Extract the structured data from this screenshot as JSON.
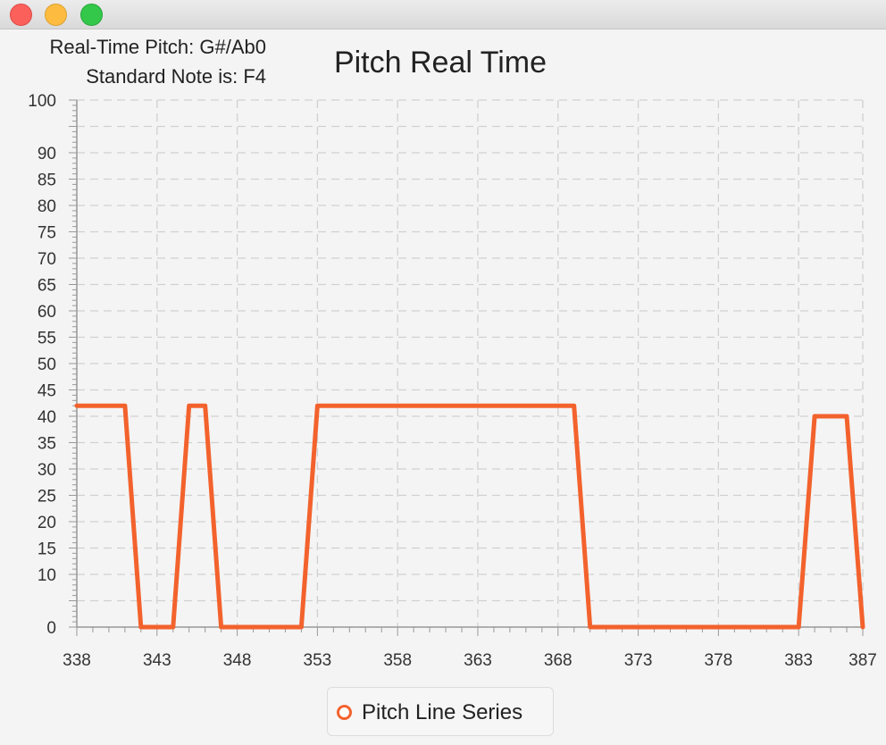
{
  "window": {
    "controls": [
      "close",
      "minimize",
      "zoom"
    ]
  },
  "info": {
    "realtime_pitch": "Real-Time Pitch: G#/Ab0",
    "standard_note": "Standard Note is: F4"
  },
  "colors": {
    "series": "#f3622d",
    "grid": "#d0d0d0",
    "axis": "#999999"
  },
  "chart_data": {
    "type": "line",
    "title": "Pitch Real Time",
    "xlabel": "",
    "ylabel": "",
    "xlim": [
      338,
      387
    ],
    "ylim": [
      0,
      100
    ],
    "x_ticks": [
      338,
      343,
      348,
      353,
      358,
      363,
      368,
      373,
      378,
      383,
      387
    ],
    "y_ticks": [
      0,
      10,
      15,
      20,
      25,
      30,
      35,
      40,
      45,
      50,
      55,
      60,
      65,
      70,
      75,
      80,
      85,
      90,
      100
    ],
    "grid": true,
    "legend_position": "bottom-center",
    "series": [
      {
        "name": "Pitch Line Series",
        "x": [
          338,
          339,
          340,
          341,
          342,
          343,
          344,
          345,
          346,
          347,
          348,
          349,
          350,
          351,
          352,
          353,
          354,
          355,
          356,
          357,
          358,
          359,
          360,
          361,
          362,
          363,
          364,
          365,
          366,
          367,
          368,
          369,
          370,
          371,
          372,
          373,
          374,
          375,
          376,
          377,
          378,
          379,
          380,
          381,
          382,
          383,
          384,
          385,
          386,
          387
        ],
        "values": [
          42,
          42,
          42,
          42,
          0,
          0,
          0,
          42,
          42,
          0,
          0,
          0,
          0,
          0,
          0,
          42,
          42,
          42,
          42,
          42,
          42,
          42,
          42,
          42,
          42,
          42,
          42,
          42,
          42,
          42,
          42,
          42,
          0,
          0,
          0,
          0,
          0,
          0,
          0,
          0,
          0,
          0,
          0,
          0,
          0,
          0,
          40,
          40,
          40,
          0
        ]
      }
    ]
  }
}
